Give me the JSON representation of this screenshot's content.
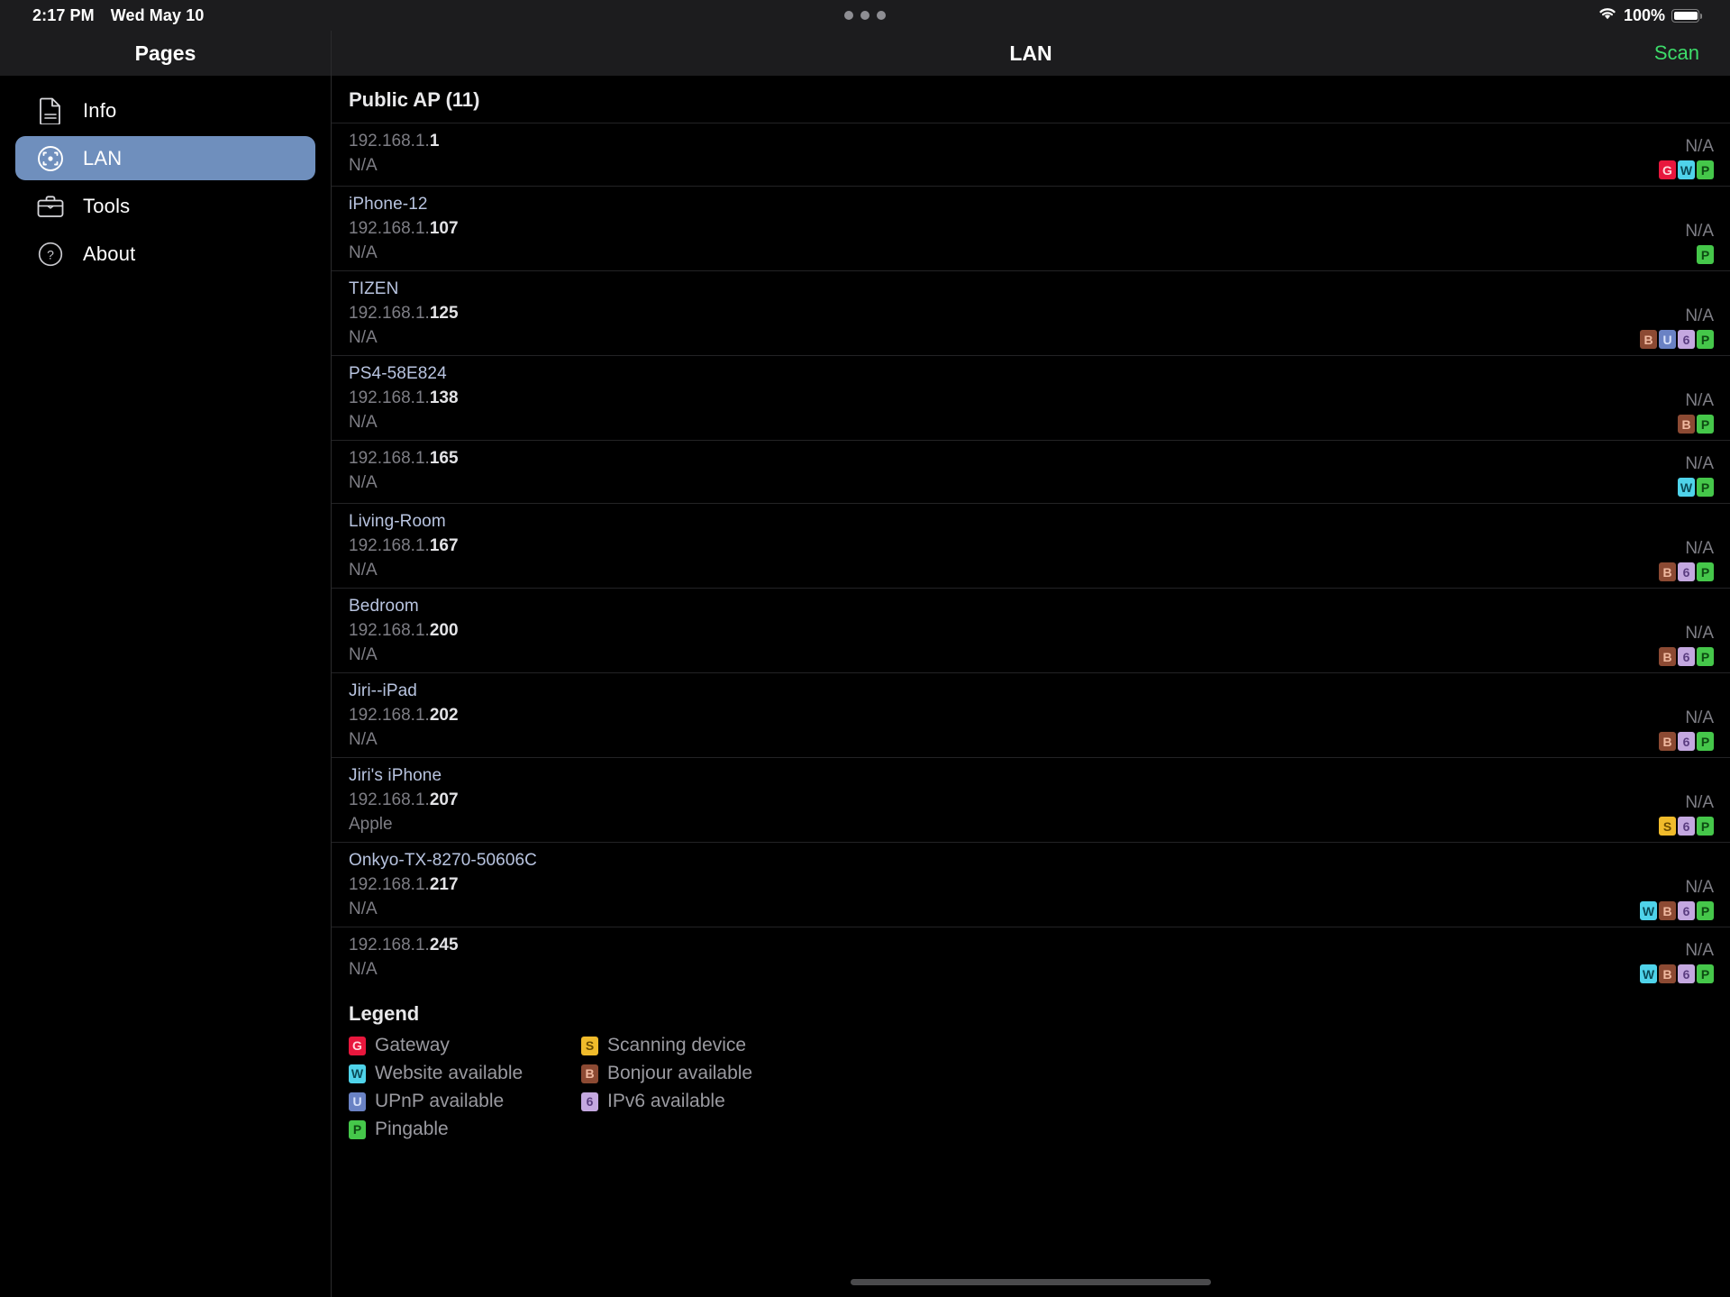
{
  "status_bar": {
    "time": "2:17 PM",
    "date": "Wed May 10",
    "battery_percent": "100%",
    "wifi_icon": "wifi-icon",
    "battery_icon": "battery-full-icon",
    "multitask_icon": "multitasking-dots-icon"
  },
  "sidebar": {
    "title": "Pages",
    "items": [
      {
        "label": "Info",
        "icon": "document-icon",
        "selected": false
      },
      {
        "label": "LAN",
        "icon": "viewfinder-icon",
        "selected": true
      },
      {
        "label": "Tools",
        "icon": "briefcase-icon",
        "selected": false
      },
      {
        "label": "About",
        "icon": "question-circle-icon",
        "selected": false
      }
    ]
  },
  "navbar": {
    "title": "LAN",
    "action_label": "Scan",
    "action_color": "#3ddc6a"
  },
  "list": {
    "section_title": "Public AP (11)",
    "devices": [
      {
        "name": "",
        "ip_prefix": "192.168.1.",
        "ip_octet": "1",
        "vendor": "N/A",
        "rtt": "N/A",
        "badges": [
          "G",
          "W",
          "P"
        ]
      },
      {
        "name": "iPhone-12",
        "ip_prefix": "192.168.1.",
        "ip_octet": "107",
        "vendor": "N/A",
        "rtt": "N/A",
        "badges": [
          "P"
        ]
      },
      {
        "name": "TIZEN",
        "ip_prefix": "192.168.1.",
        "ip_octet": "125",
        "vendor": "N/A",
        "rtt": "N/A",
        "badges": [
          "B",
          "U",
          "6",
          "P"
        ]
      },
      {
        "name": "PS4-58E824",
        "ip_prefix": "192.168.1.",
        "ip_octet": "138",
        "vendor": "N/A",
        "rtt": "N/A",
        "badges": [
          "B",
          "P"
        ]
      },
      {
        "name": "",
        "ip_prefix": "192.168.1.",
        "ip_octet": "165",
        "vendor": "N/A",
        "rtt": "N/A",
        "badges": [
          "W",
          "P"
        ]
      },
      {
        "name": "Living-Room",
        "ip_prefix": "192.168.1.",
        "ip_octet": "167",
        "vendor": "N/A",
        "rtt": "N/A",
        "badges": [
          "B",
          "6",
          "P"
        ]
      },
      {
        "name": "Bedroom",
        "ip_prefix": "192.168.1.",
        "ip_octet": "200",
        "vendor": "N/A",
        "rtt": "N/A",
        "badges": [
          "B",
          "6",
          "P"
        ]
      },
      {
        "name": "Jiri--iPad",
        "ip_prefix": "192.168.1.",
        "ip_octet": "202",
        "vendor": "N/A",
        "rtt": "N/A",
        "badges": [
          "B",
          "6",
          "P"
        ]
      },
      {
        "name": "Jiri's iPhone",
        "ip_prefix": "192.168.1.",
        "ip_octet": "207",
        "vendor": "Apple",
        "rtt": "N/A",
        "badges": [
          "S",
          "6",
          "P"
        ]
      },
      {
        "name": "Onkyo-TX-8270-50606C",
        "ip_prefix": "192.168.1.",
        "ip_octet": "217",
        "vendor": "N/A",
        "rtt": "N/A",
        "badges": [
          "W",
          "B",
          "6",
          "P"
        ]
      },
      {
        "name": "",
        "ip_prefix": "192.168.1.",
        "ip_octet": "245",
        "vendor": "N/A",
        "rtt": "N/A",
        "badges": [
          "W",
          "B",
          "6",
          "P"
        ]
      }
    ]
  },
  "legend": {
    "title": "Legend",
    "items": [
      {
        "code": "G",
        "label": "Gateway",
        "color": "#e8173d"
      },
      {
        "code": "S",
        "label": "Scanning device",
        "color": "#f0bb2b"
      },
      {
        "code": "W",
        "label": "Website available",
        "color": "#4fd3ea"
      },
      {
        "code": "B",
        "label": "Bonjour available",
        "color": "#8c4a33"
      },
      {
        "code": "U",
        "label": "UPnP available",
        "color": "#6a82c4"
      },
      {
        "code": "6",
        "label": "IPv6 available",
        "color": "#c4a8e0"
      },
      {
        "code": "P",
        "label": "Pingable",
        "color": "#45c74a"
      }
    ]
  }
}
